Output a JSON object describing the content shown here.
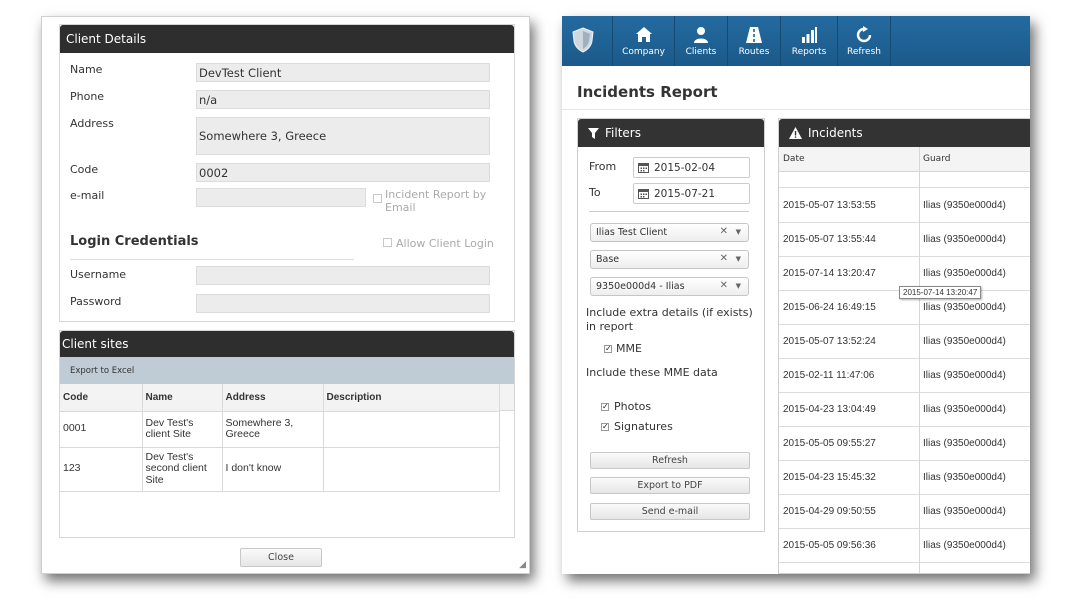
{
  "client_details": {
    "header": "Client Details",
    "fields": [
      {
        "label": "Name",
        "value": "DevTest Client"
      },
      {
        "label": "Phone",
        "value": "n/a"
      },
      {
        "label": "Address",
        "value": "Somewhere 3, Greece"
      },
      {
        "label": "Code",
        "value": "0002"
      },
      {
        "label": "e-mail",
        "value": ""
      }
    ],
    "incident_report_by_email": "Incident Report by Email",
    "login_title": "Login Credentials",
    "allow_client_login": "Allow Client Login",
    "username_label": "Username",
    "password_label": "Password"
  },
  "client_sites": {
    "header": "Client sites",
    "export_label": "Export to Excel",
    "columns": [
      "Code",
      "Name",
      "Address",
      "Description"
    ],
    "rows": [
      {
        "code": "0001",
        "name": "Dev Test's client Site",
        "address": "Somewhere 3, Greece",
        "description": ""
      },
      {
        "code": "123",
        "name": "Dev Test's second client Site",
        "address": "I don't know",
        "description": ""
      }
    ]
  },
  "close_label": "Close",
  "nav": {
    "items": [
      {
        "label": "Company",
        "icon": "home-icon"
      },
      {
        "label": "Clients",
        "icon": "user-icon"
      },
      {
        "label": "Routes",
        "icon": "road-icon"
      },
      {
        "label": "Reports",
        "icon": "bar-chart-icon"
      },
      {
        "label": "Refresh",
        "icon": "refresh-icon"
      }
    ]
  },
  "page_title": "Incidents Report",
  "filters": {
    "header": "Filters",
    "from_label": "From",
    "from_value": "2015-02-04",
    "to_label": "To",
    "to_value": "2015-07-21",
    "selects": [
      "Ilias Test Client",
      "Base",
      "9350e000d4 - Ilias"
    ],
    "extra_details_label": "Include extra details (if exists) in report",
    "mme_label": "MME",
    "mme_data_label": "Include these MME data",
    "photos_label": "Photos",
    "signatures_label": "Signatures",
    "buttons": [
      "Refresh",
      "Export to PDF",
      "Send e-mail"
    ]
  },
  "incidents": {
    "header": "Incidents",
    "columns": [
      "Date",
      "Guard"
    ],
    "rows": [
      {
        "date": "2015-05-07 13:53:55",
        "guard": "Ilias (9350e000d4)"
      },
      {
        "date": "2015-05-07 13:55:44",
        "guard": "Ilias (9350e000d4)"
      },
      {
        "date": "2015-07-14 13:20:47",
        "guard": "Ilias (9350e000d4)"
      },
      {
        "date": "2015-06-24 16:49:15",
        "guard": "Ilias (9350e000d4)"
      },
      {
        "date": "2015-05-07 13:52:24",
        "guard": "Ilias (9350e000d4)"
      },
      {
        "date": "2015-02-11 11:47:06",
        "guard": "Ilias (9350e000d4)"
      },
      {
        "date": "2015-04-23 13:04:49",
        "guard": "Ilias (9350e000d4)"
      },
      {
        "date": "2015-05-05 09:55:27",
        "guard": "Ilias (9350e000d4)"
      },
      {
        "date": "2015-04-23 15:45:32",
        "guard": "Ilias (9350e000d4)"
      },
      {
        "date": "2015-04-29 09:50:55",
        "guard": "Ilias (9350e000d4)"
      },
      {
        "date": "2015-05-05 09:56:36",
        "guard": "Ilias (9350e000d4)"
      }
    ],
    "tooltip": "2015-07-14 13:20:47"
  },
  "colors": {
    "panel_header": "#2e2e2e",
    "navbar": "#1f6396",
    "toolbar": "#bfccd6"
  }
}
